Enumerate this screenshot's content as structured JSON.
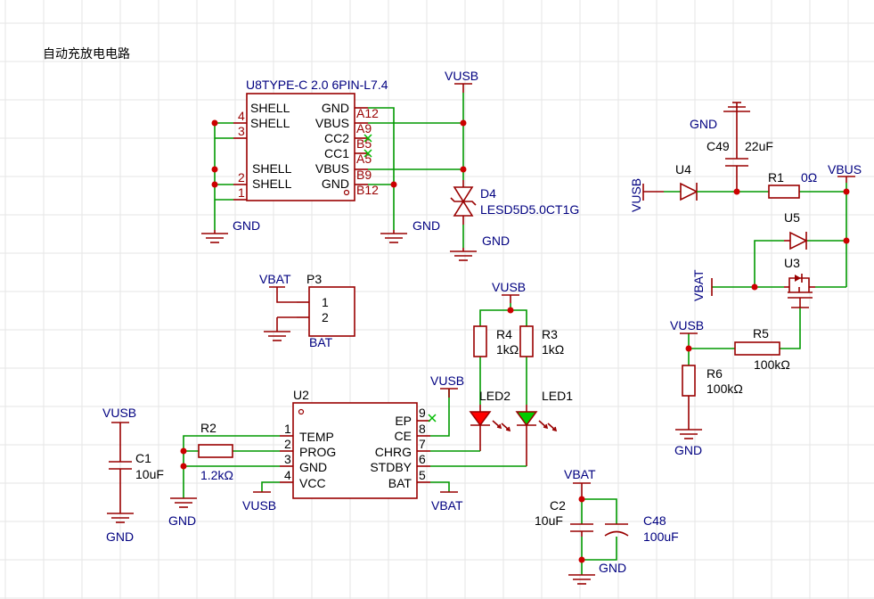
{
  "title": "自动充放电电路",
  "nets": {
    "vusb": "VUSB",
    "vbus": "VBUS",
    "vbat": "VBAT",
    "gnd": "GND"
  },
  "u8": {
    "label": "U8TYPE-C 2.0 6PIN-L7.4",
    "left_pins": [
      {
        "num": "4",
        "name": "SHELL"
      },
      {
        "num": "3",
        "name": "SHELL"
      },
      {
        "num": "2",
        "name": "SHELL"
      },
      {
        "num": "1",
        "name": "SHELL"
      }
    ],
    "right_pins": [
      {
        "name": "GND",
        "num": "A12"
      },
      {
        "name": "VBUS",
        "num": "A9"
      },
      {
        "name": "CC2",
        "num": "B5"
      },
      {
        "name": "CC1",
        "num": "A5"
      },
      {
        "name": "VBUS",
        "num": "B9"
      },
      {
        "name": "GND",
        "num": "B12"
      }
    ]
  },
  "d4": {
    "ref": "D4",
    "value": "LESD5D5.0CT1G"
  },
  "p3": {
    "ref": "P3",
    "pins": [
      "1",
      "2"
    ],
    "net_label": "BAT"
  },
  "u2": {
    "ref": "U2",
    "left_pins": [
      {
        "num": "1",
        "name": "TEMP"
      },
      {
        "num": "2",
        "name": "PROG"
      },
      {
        "num": "3",
        "name": "GND"
      },
      {
        "num": "4",
        "name": "VCC"
      }
    ],
    "right_pins": [
      {
        "num": "9",
        "name": "EP"
      },
      {
        "num": "8",
        "name": "CE"
      },
      {
        "num": "7",
        "name": "CHRG"
      },
      {
        "num": "6",
        "name": "STDBY"
      },
      {
        "num": "5",
        "name": "BAT"
      }
    ]
  },
  "r2": {
    "ref": "R2",
    "value": "1.2kΩ"
  },
  "c1": {
    "ref": "C1",
    "value": "10uF"
  },
  "r4": {
    "ref": "R4",
    "value": "1kΩ"
  },
  "r3": {
    "ref": "R3",
    "value": "1kΩ"
  },
  "led2": {
    "ref": "LED2",
    "color": "#ff0000"
  },
  "led1": {
    "ref": "LED1",
    "color": "#00cc00"
  },
  "c2": {
    "ref": "C2",
    "value": "10uF"
  },
  "c48": {
    "ref": "C48",
    "value": "100uF"
  },
  "c49": {
    "ref": "C49",
    "value": "22uF"
  },
  "u4": {
    "ref": "U4"
  },
  "u5": {
    "ref": "U5"
  },
  "u3": {
    "ref": "U3"
  },
  "r1": {
    "ref": "R1",
    "value": "0Ω"
  },
  "r5": {
    "ref": "R5",
    "value": "100kΩ"
  },
  "r6": {
    "ref": "R6",
    "value": "100kΩ"
  },
  "colors": {
    "wire": "#009900",
    "part": "#990000",
    "net_text": "#000080",
    "junction": "#cc0000"
  }
}
